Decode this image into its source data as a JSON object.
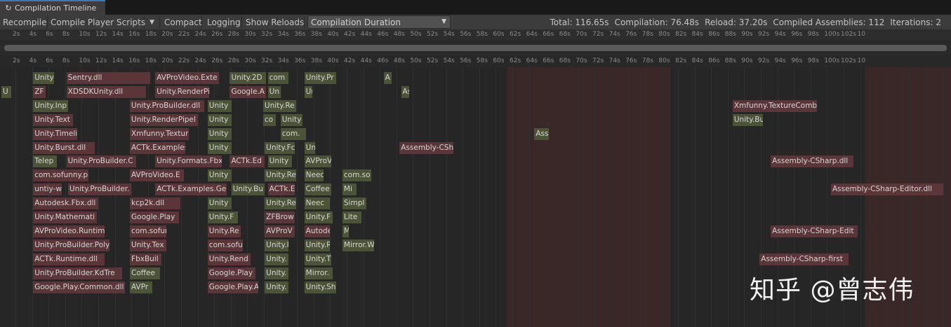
{
  "tab": {
    "title": "Compilation Timeline",
    "icon": "refresh-icon"
  },
  "toolbar": {
    "recompile": "Recompile",
    "compile_player_scripts": "Compile Player Scripts",
    "compact": "Compact",
    "logging": "Logging",
    "show_reloads": "Show Reloads",
    "mode_selected": "Compilation Duration"
  },
  "stats": {
    "total": "Total: 116.65s",
    "compilation": "Compilation: 76.48s",
    "reload": "Reload: 37.20s",
    "assemblies": "Compiled Assemblies: 112",
    "iterations": "Iterations: 2"
  },
  "ruler_ticks": [
    "2s",
    "4s",
    "6s",
    "8s",
    "10s",
    "12s",
    "14s",
    "16s",
    "18s",
    "20s",
    "22s",
    "24s",
    "26s",
    "28s",
    "30s",
    "32s",
    "34s",
    "36s",
    "38s",
    "40s",
    "42s",
    "44s",
    "46s",
    "48s",
    "50s",
    "52s",
    "54s",
    "56s",
    "58s",
    "60s",
    "62s",
    "64s",
    "66s",
    "68s",
    "70s",
    "72s",
    "74s",
    "76s",
    "78s",
    "80s",
    "82s",
    "84s",
    "86s",
    "88s",
    "90s",
    "92s",
    "94s",
    "96s",
    "98s",
    "100s",
    "102s",
    "10"
  ],
  "bars": [
    {
      "t": "Unity",
      "row": 0,
      "s": 20,
      "e": 33,
      "c": "g"
    },
    {
      "t": "Sentry.dll",
      "row": 0,
      "s": 41,
      "e": 94,
      "c": "r"
    },
    {
      "t": "AVProVideo.Exte",
      "row": 0,
      "s": 97,
      "e": 137,
      "c": "r"
    },
    {
      "t": "Unity.2D",
      "row": 0,
      "s": 144,
      "e": 167,
      "c": "g"
    },
    {
      "t": "com",
      "row": 0,
      "s": 168,
      "e": 181,
      "c": "g"
    },
    {
      "t": "Unity.Pr",
      "row": 0,
      "s": 191,
      "e": 211,
      "c": "g"
    },
    {
      "t": "A",
      "row": 0,
      "s": 241,
      "e": 246,
      "c": "g"
    },
    {
      "t": "U",
      "row": 1,
      "s": 0,
      "e": 6,
      "c": "g"
    },
    {
      "t": "ZF",
      "row": 1,
      "s": 20,
      "e": 28,
      "c": "r"
    },
    {
      "t": "XDSDKUnity.dll",
      "row": 1,
      "s": 41,
      "e": 91,
      "c": "r"
    },
    {
      "t": "Unity.RenderPi",
      "row": 1,
      "s": 97,
      "e": 131,
      "c": "r"
    },
    {
      "t": "Google.A",
      "row": 1,
      "s": 144,
      "e": 167,
      "c": "r"
    },
    {
      "t": "Un",
      "row": 1,
      "s": 168,
      "e": 176,
      "c": "g"
    },
    {
      "t": "Ur",
      "row": 1,
      "s": 191,
      "e": 196,
      "c": "g"
    },
    {
      "t": "As",
      "row": 1,
      "s": 252,
      "e": 257,
      "c": "g"
    },
    {
      "t": "Unity.Inp",
      "row": 2,
      "s": 20,
      "e": 42,
      "c": "g"
    },
    {
      "t": "Unity.ProBuilder.dll",
      "row": 2,
      "s": 81,
      "e": 128,
      "c": "r"
    },
    {
      "t": "Unity",
      "row": 2,
      "s": 130,
      "e": 145,
      "c": "g"
    },
    {
      "t": "Unity.Re",
      "row": 2,
      "s": 165,
      "e": 186,
      "c": "g"
    },
    {
      "t": "Xmfunny.TextureComb",
      "row": 2,
      "s": 461,
      "e": 514,
      "c": "r"
    },
    {
      "t": "Unity.Text",
      "row": 3,
      "s": 20,
      "e": 45,
      "c": "r"
    },
    {
      "t": "Unity.RenderPipel",
      "row": 3,
      "s": 81,
      "e": 124,
      "c": "r"
    },
    {
      "t": "Unity",
      "row": 3,
      "s": 130,
      "e": 145,
      "c": "g"
    },
    {
      "t": "co",
      "row": 3,
      "s": 165,
      "e": 173,
      "c": "g"
    },
    {
      "t": "Unity",
      "row": 3,
      "s": 176,
      "e": 190,
      "c": "g"
    },
    {
      "t": "Unity.Bu",
      "row": 3,
      "s": 461,
      "e": 480,
      "c": "g"
    },
    {
      "t": "Unity.Timelir",
      "row": 4,
      "s": 20,
      "e": 48,
      "c": "r"
    },
    {
      "t": "Xmfunny.Textur",
      "row": 4,
      "s": 81,
      "e": 118,
      "c": "r"
    },
    {
      "t": "Unity",
      "row": 4,
      "s": 130,
      "e": 145,
      "c": "g"
    },
    {
      "t": "com.",
      "row": 4,
      "s": 176,
      "e": 192,
      "c": "g"
    },
    {
      "t": "Ass",
      "row": 4,
      "s": 336,
      "e": 345,
      "c": "g"
    },
    {
      "t": "Unity.Burst.dll",
      "row": 5,
      "s": 20,
      "e": 59,
      "c": "r"
    },
    {
      "t": "ACTk.Examples",
      "row": 5,
      "s": 81,
      "e": 116,
      "c": "r"
    },
    {
      "t": "Unity",
      "row": 5,
      "s": 130,
      "e": 145,
      "c": "g"
    },
    {
      "t": "Unity.Fc",
      "row": 5,
      "s": 166,
      "e": 185,
      "c": "g"
    },
    {
      "t": "Un",
      "row": 5,
      "s": 191,
      "e": 198,
      "c": "g"
    },
    {
      "t": "Assembly-CSh",
      "row": 5,
      "s": 251,
      "e": 285,
      "c": "r"
    },
    {
      "t": "Telep",
      "row": 6,
      "s": 20,
      "e": 35,
      "c": "g"
    },
    {
      "t": "Unity.ProBuilder.C",
      "row": 6,
      "s": 41,
      "e": 85,
      "c": "r"
    },
    {
      "t": "Unity.Formats.Fbx",
      "row": 6,
      "s": 97,
      "e": 139,
      "c": "r"
    },
    {
      "t": "ACTk.Ed",
      "row": 6,
      "s": 144,
      "e": 166,
      "c": "r"
    },
    {
      "t": "Unity",
      "row": 6,
      "s": 168,
      "e": 183,
      "c": "g"
    },
    {
      "t": "AVProV",
      "row": 6,
      "s": 191,
      "e": 208,
      "c": "g"
    },
    {
      "t": "Assembly-CSharp.dll",
      "row": 6,
      "s": 485,
      "e": 537,
      "c": "r"
    },
    {
      "t": "com.sofunny.p",
      "row": 7,
      "s": 20,
      "e": 55,
      "c": "r"
    },
    {
      "t": "AVProVideo.E",
      "row": 7,
      "s": 81,
      "e": 115,
      "c": "r"
    },
    {
      "t": "Unity",
      "row": 7,
      "s": 130,
      "e": 145,
      "c": "g"
    },
    {
      "t": "Unity.Re",
      "row": 7,
      "s": 166,
      "e": 186,
      "c": "g"
    },
    {
      "t": "Neec",
      "row": 7,
      "s": 191,
      "e": 203,
      "c": "g"
    },
    {
      "t": "com.so",
      "row": 7,
      "s": 215,
      "e": 233,
      "c": "g"
    },
    {
      "t": "untiy-w",
      "row": 8,
      "s": 20,
      "e": 38,
      "c": "r"
    },
    {
      "t": "Unity.ProBuilder.",
      "row": 8,
      "s": 42,
      "e": 82,
      "c": "r"
    },
    {
      "t": "ACTk.Examples.Ger",
      "row": 8,
      "s": 97,
      "e": 142,
      "c": "r"
    },
    {
      "t": "Unity.Bu",
      "row": 8,
      "s": 145,
      "e": 166,
      "c": "g"
    },
    {
      "t": "ACTk.E",
      "row": 8,
      "s": 168,
      "e": 185,
      "c": "r"
    },
    {
      "t": "Coffee",
      "row": 8,
      "s": 191,
      "e": 208,
      "c": "g"
    },
    {
      "t": "Mi",
      "row": 8,
      "s": 215,
      "e": 224,
      "c": "g"
    },
    {
      "t": "Assembly-CSharp-Editor.dll",
      "row": 8,
      "s": 523,
      "e": 594,
      "c": "r"
    },
    {
      "t": "Autodesk.Fbx.dll",
      "row": 9,
      "s": 20,
      "e": 61,
      "c": "r"
    },
    {
      "t": "kcp2k.dll",
      "row": 9,
      "s": 81,
      "e": 113,
      "c": "r"
    },
    {
      "t": "Unity",
      "row": 9,
      "s": 130,
      "e": 145,
      "c": "g"
    },
    {
      "t": "Unity.Re",
      "row": 9,
      "s": 166,
      "e": 186,
      "c": "g"
    },
    {
      "t": "Neec",
      "row": 9,
      "s": 191,
      "e": 207,
      "c": "g"
    },
    {
      "t": "Simpl",
      "row": 9,
      "s": 215,
      "e": 230,
      "c": "g"
    },
    {
      "t": "Unity.Mathemati",
      "row": 10,
      "s": 20,
      "e": 60,
      "c": "r"
    },
    {
      "t": "Google.Play",
      "row": 10,
      "s": 81,
      "e": 112,
      "c": "r"
    },
    {
      "t": "Unity.F",
      "row": 10,
      "s": 130,
      "e": 149,
      "c": "g"
    },
    {
      "t": "ZFBrow",
      "row": 10,
      "s": 166,
      "e": 185,
      "c": "r"
    },
    {
      "t": "Unity.F",
      "row": 10,
      "s": 191,
      "e": 209,
      "c": "g"
    },
    {
      "t": "Lite",
      "row": 10,
      "s": 215,
      "e": 227,
      "c": "g"
    },
    {
      "t": "AVProVideo.Runtim",
      "row": 11,
      "s": 20,
      "e": 65,
      "c": "r"
    },
    {
      "t": "com.sofur",
      "row": 11,
      "s": 81,
      "e": 104,
      "c": "r"
    },
    {
      "t": "Unity.Re",
      "row": 11,
      "s": 130,
      "e": 151,
      "c": "r"
    },
    {
      "t": "AVProV",
      "row": 11,
      "s": 166,
      "e": 185,
      "c": "r"
    },
    {
      "t": "Autode",
      "row": 11,
      "s": 191,
      "e": 207,
      "c": "r"
    },
    {
      "t": "M",
      "row": 11,
      "s": 215,
      "e": 219,
      "c": "g"
    },
    {
      "t": "Assembly-CSharp-Edit",
      "row": 11,
      "s": 485,
      "e": 540,
      "c": "r"
    },
    {
      "t": "Unity.ProBuilder.Poly",
      "row": 12,
      "s": 20,
      "e": 68,
      "c": "r"
    },
    {
      "t": "Unity.Tex",
      "row": 12,
      "s": 81,
      "e": 104,
      "c": "r"
    },
    {
      "t": "com.sofu",
      "row": 12,
      "s": 130,
      "e": 152,
      "c": "r"
    },
    {
      "t": "Unity.I",
      "row": 12,
      "s": 166,
      "e": 181,
      "c": "g"
    },
    {
      "t": "Unity.R",
      "row": 12,
      "s": 191,
      "e": 207,
      "c": "g"
    },
    {
      "t": "Mirror.W",
      "row": 12,
      "s": 215,
      "e": 235,
      "c": "g"
    },
    {
      "t": "ACTk.Runtime.dll",
      "row": 13,
      "s": 20,
      "e": 65,
      "c": "r"
    },
    {
      "t": "FbxBuil",
      "row": 13,
      "s": 81,
      "e": 101,
      "c": "r"
    },
    {
      "t": "Unity.Rend",
      "row": 13,
      "s": 130,
      "e": 157,
      "c": "r"
    },
    {
      "t": "Unity.",
      "row": 13,
      "s": 166,
      "e": 181,
      "c": "g"
    },
    {
      "t": "Unity.T",
      "row": 13,
      "s": 191,
      "e": 208,
      "c": "g"
    },
    {
      "t": "Assembly-CSharp-first",
      "row": 13,
      "s": 478,
      "e": 534,
      "c": "r"
    },
    {
      "t": "Unity.ProBuilder.KdTre",
      "row": 14,
      "s": 20,
      "e": 76,
      "c": "r"
    },
    {
      "t": "Coffee",
      "row": 14,
      "s": 81,
      "e": 100,
      "c": "g"
    },
    {
      "t": "Google.Play",
      "row": 14,
      "s": 130,
      "e": 160,
      "c": "r"
    },
    {
      "t": "Unity.",
      "row": 14,
      "s": 166,
      "e": 181,
      "c": "g"
    },
    {
      "t": "Mirror.",
      "row": 14,
      "s": 191,
      "e": 209,
      "c": "g"
    },
    {
      "t": "Google.Play.Common.dll",
      "row": 15,
      "s": 20,
      "e": 78,
      "c": "r"
    },
    {
      "t": "AVPr",
      "row": 15,
      "s": 81,
      "e": 95,
      "c": "g"
    },
    {
      "t": "Google.Play.A",
      "row": 15,
      "s": 130,
      "e": 162,
      "c": "r"
    },
    {
      "t": "Unity.",
      "row": 15,
      "s": 166,
      "e": 181,
      "c": "g"
    },
    {
      "t": "Unity.Sh",
      "row": 15,
      "s": 191,
      "e": 211,
      "c": "g"
    }
  ],
  "watermark": "知乎 @曾志伟"
}
